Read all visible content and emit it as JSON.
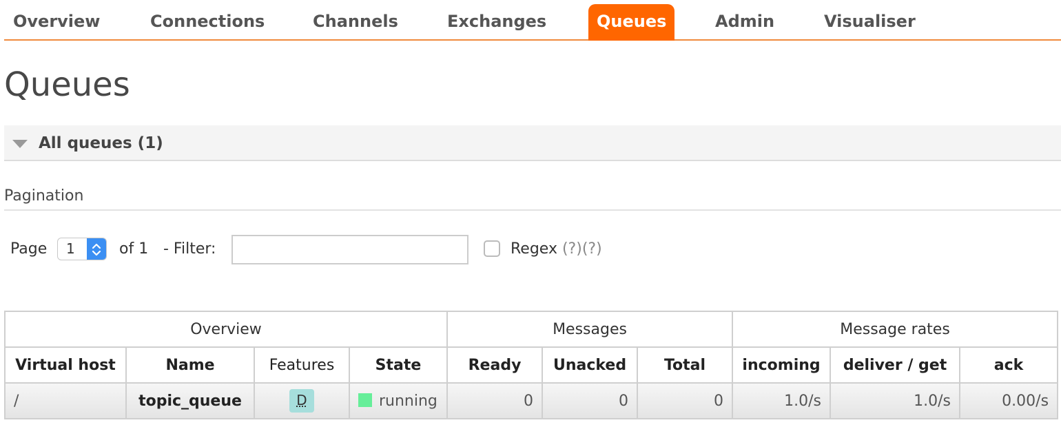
{
  "nav": {
    "tabs": [
      {
        "label": "Overview",
        "active": false
      },
      {
        "label": "Connections",
        "active": false
      },
      {
        "label": "Channels",
        "active": false
      },
      {
        "label": "Exchanges",
        "active": false
      },
      {
        "label": "Queues",
        "active": true
      },
      {
        "label": "Admin",
        "active": false
      },
      {
        "label": "Visualiser",
        "active": false
      }
    ],
    "accent_color": "#ff6600"
  },
  "page": {
    "title": "Queues"
  },
  "section": {
    "label": "All queues (1)",
    "icon": "triangle-down-icon"
  },
  "pagination": {
    "heading": "Pagination",
    "page_label": "Page",
    "current_page": "1",
    "of_label": "of 1",
    "filter_label": "- Filter:",
    "filter_value": "",
    "regex_label": "Regex",
    "help1": "(?)",
    "help2": "(?)"
  },
  "table": {
    "groups": [
      "Overview",
      "Messages",
      "Message rates"
    ],
    "columns": [
      "Virtual host",
      "Name",
      "Features",
      "State",
      "Ready",
      "Unacked",
      "Total",
      "incoming",
      "deliver / get",
      "ack"
    ],
    "rows": [
      {
        "vhost": "/",
        "name": "topic_queue",
        "feature": "D",
        "state": "running",
        "state_color": "#66ee99",
        "ready": "0",
        "unacked": "0",
        "total": "0",
        "incoming": "1.0/s",
        "deliver_get": "1.0/s",
        "ack": "0.00/s"
      }
    ]
  }
}
